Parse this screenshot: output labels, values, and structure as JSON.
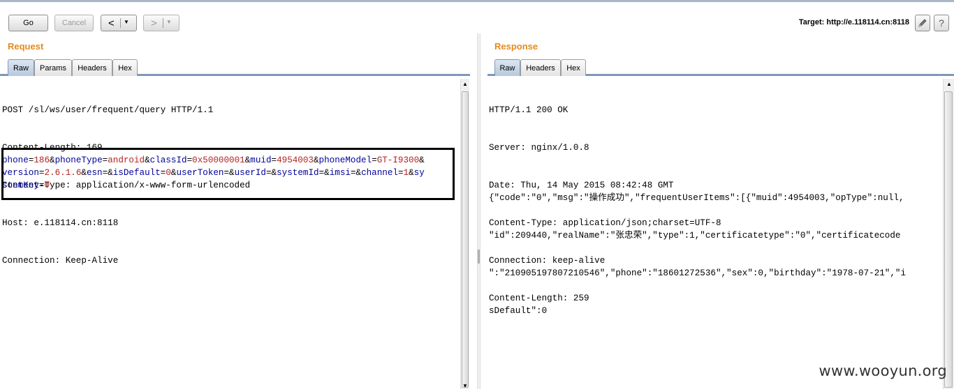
{
  "toolbar": {
    "go_label": "Go",
    "cancel_label": "Cancel",
    "back_arrow": "<",
    "forward_arrow": ">",
    "dropdown_glyph": "▼",
    "target_text": "Target: http://e.118114.cn:8118",
    "edit_icon": "pencil-icon",
    "help_label": "?"
  },
  "request": {
    "title": "Request",
    "tabs": [
      "Raw",
      "Params",
      "Headers",
      "Hex"
    ],
    "active_tab": "Raw",
    "headers": [
      "POST /sl/ws/user/frequent/query HTTP/1.1",
      "Content-Length: 169",
      "Content-Type: application/x-www-form-urlencoded",
      "Host: e.118114.cn:8118",
      "Connection: Keep-Alive"
    ],
    "body_lines": [
      [
        {
          "t": "phone",
          "c": "pn"
        },
        {
          "t": "=",
          "c": "pk"
        },
        {
          "t": "186",
          "c": "pv"
        },
        {
          "t": "&",
          "c": "pk"
        },
        {
          "t": "phoneType",
          "c": "pn"
        },
        {
          "t": "=",
          "c": "pk"
        },
        {
          "t": "android",
          "c": "pv"
        },
        {
          "t": "&",
          "c": "pk"
        },
        {
          "t": "classId",
          "c": "pn"
        },
        {
          "t": "=",
          "c": "pk"
        },
        {
          "t": "0x50000001",
          "c": "pv"
        },
        {
          "t": "&",
          "c": "pk"
        },
        {
          "t": "muid",
          "c": "pn"
        },
        {
          "t": "=",
          "c": "pk"
        },
        {
          "t": "4954003",
          "c": "pv"
        },
        {
          "t": "&",
          "c": "pk"
        },
        {
          "t": "phoneModel",
          "c": "pn"
        },
        {
          "t": "=",
          "c": "pk"
        },
        {
          "t": "GT-I9300",
          "c": "pv"
        },
        {
          "t": "&",
          "c": "pk"
        }
      ],
      [
        {
          "t": "version",
          "c": "pn"
        },
        {
          "t": "=",
          "c": "pk"
        },
        {
          "t": "2.6.1.6",
          "c": "pv"
        },
        {
          "t": "&",
          "c": "pk"
        },
        {
          "t": "esn",
          "c": "pn"
        },
        {
          "t": "=&",
          "c": "pk"
        },
        {
          "t": "isDefault",
          "c": "pn"
        },
        {
          "t": "=",
          "c": "pk"
        },
        {
          "t": "0",
          "c": "pv"
        },
        {
          "t": "&",
          "c": "pk"
        },
        {
          "t": "userToken",
          "c": "pn"
        },
        {
          "t": "=&",
          "c": "pk"
        },
        {
          "t": "userId",
          "c": "pn"
        },
        {
          "t": "=&",
          "c": "pk"
        },
        {
          "t": "systemId",
          "c": "pn"
        },
        {
          "t": "=&",
          "c": "pk"
        },
        {
          "t": "imsi",
          "c": "pn"
        },
        {
          "t": "=&",
          "c": "pk"
        },
        {
          "t": "channel",
          "c": "pn"
        },
        {
          "t": "=",
          "c": "pk"
        },
        {
          "t": "1",
          "c": "pv"
        },
        {
          "t": "&",
          "c": "pk"
        },
        {
          "t": "sy",
          "c": "pn"
        }
      ],
      [
        {
          "t": "stemKey",
          "c": "pn"
        },
        {
          "t": "=",
          "c": "pk"
        },
        {
          "t": "0",
          "c": "pv"
        }
      ]
    ]
  },
  "response": {
    "title": "Response",
    "tabs": [
      "Raw",
      "Headers",
      "Hex"
    ],
    "active_tab": "Raw",
    "headers": [
      "HTTP/1.1 200 OK",
      "Server: nginx/1.0.8",
      "Date: Thu, 14 May 2015 08:42:48 GMT",
      "Content-Type: application/json;charset=UTF-8",
      "Connection: keep-alive",
      "Content-Length: 259"
    ],
    "body_lines": [
      "{\"code\":\"0\",\"msg\":\"操作成功\",\"frequentUserItems\":[{\"muid\":4954003,\"opType\":null,",
      "\"id\":209440,\"realName\":\"张忠荣\",\"type\":1,\"certificatetype\":\"0\",\"certificatecode",
      "\":\"210905197807210546\",\"phone\":\"18601272536\",\"sex\":0,\"birthday\":\"1978-07-21\",\"i",
      "sDefault\":0"
    ]
  },
  "watermark": "www.wooyun.org"
}
